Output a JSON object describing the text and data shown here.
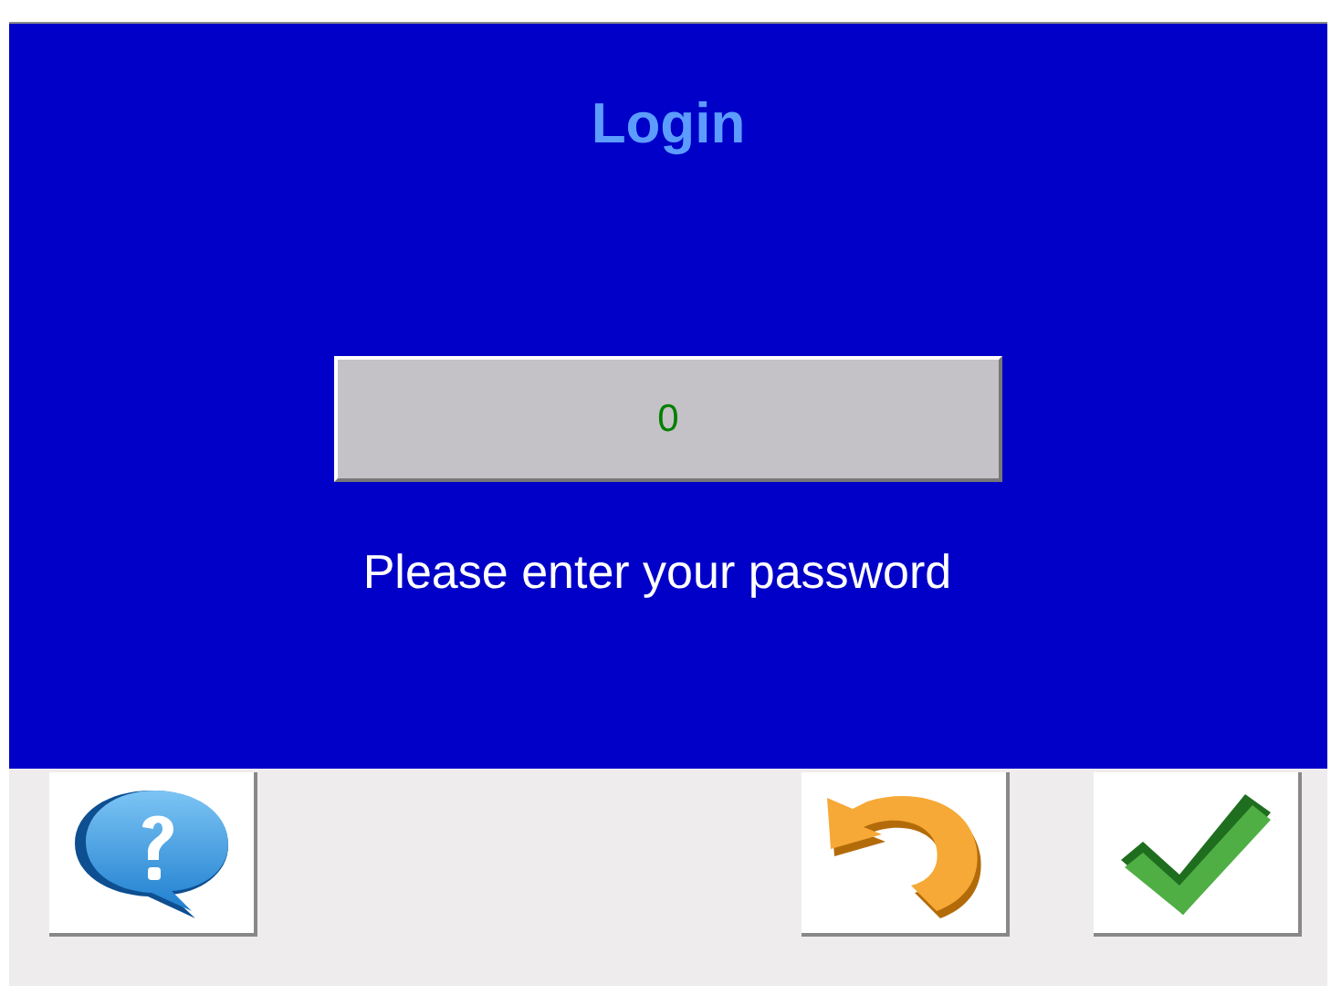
{
  "title": "Login",
  "password_field": {
    "value": "0"
  },
  "prompt": "Please enter your password",
  "buttons": [
    {
      "kind": "help"
    },
    {
      "kind": "undo"
    },
    {
      "kind": "confirm"
    }
  ]
}
